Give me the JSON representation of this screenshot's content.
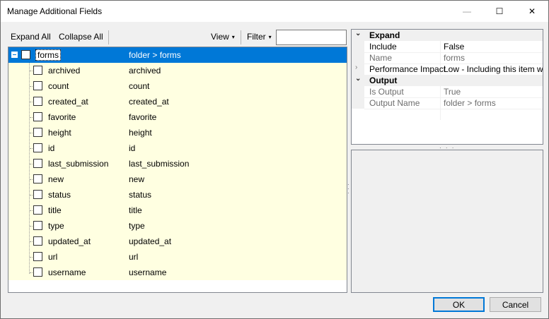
{
  "window": {
    "title": "Manage Additional Fields",
    "minimize_glyph": "—",
    "maximize_glyph": "☐",
    "close_glyph": "✕"
  },
  "toolbar": {
    "expand_all": "Expand All",
    "collapse_all": "Collapse All",
    "view": "View",
    "filter": "Filter",
    "caret": "▾",
    "filter_value": ""
  },
  "tree": {
    "root": {
      "name": "forms",
      "value": "folder > forms",
      "expander": "minus"
    },
    "children": [
      {
        "name": "archived",
        "value": "archived"
      },
      {
        "name": "count",
        "value": "count"
      },
      {
        "name": "created_at",
        "value": "created_at"
      },
      {
        "name": "favorite",
        "value": "favorite"
      },
      {
        "name": "height",
        "value": "height"
      },
      {
        "name": "id",
        "value": "id"
      },
      {
        "name": "last_submission",
        "value": "last_submission"
      },
      {
        "name": "new",
        "value": "new"
      },
      {
        "name": "status",
        "value": "status"
      },
      {
        "name": "title",
        "value": "title"
      },
      {
        "name": "type",
        "value": "type"
      },
      {
        "name": "updated_at",
        "value": "updated_at"
      },
      {
        "name": "url",
        "value": "url"
      },
      {
        "name": "username",
        "value": "username"
      }
    ]
  },
  "properties": {
    "rows": [
      {
        "kind": "category",
        "key": "Expand",
        "value": "",
        "arrow": "⌄"
      },
      {
        "kind": "normal",
        "key": "Include",
        "value": "False",
        "arrow": ""
      },
      {
        "kind": "dim",
        "key": "Name",
        "value": "forms",
        "arrow": ""
      },
      {
        "kind": "normal",
        "key": "Performance Impact",
        "value": "Low - Including this item will h",
        "arrow": "›"
      },
      {
        "kind": "category",
        "key": "Output",
        "value": "",
        "arrow": "⌄"
      },
      {
        "kind": "dim",
        "key": "Is Output",
        "value": "True",
        "arrow": ""
      },
      {
        "kind": "dim",
        "key": "Output Name",
        "value": "folder > forms",
        "arrow": ""
      }
    ]
  },
  "buttons": {
    "ok": "OK",
    "cancel": "Cancel"
  },
  "colors": {
    "selection": "#0078d7",
    "row_background": "#ffffe1"
  }
}
